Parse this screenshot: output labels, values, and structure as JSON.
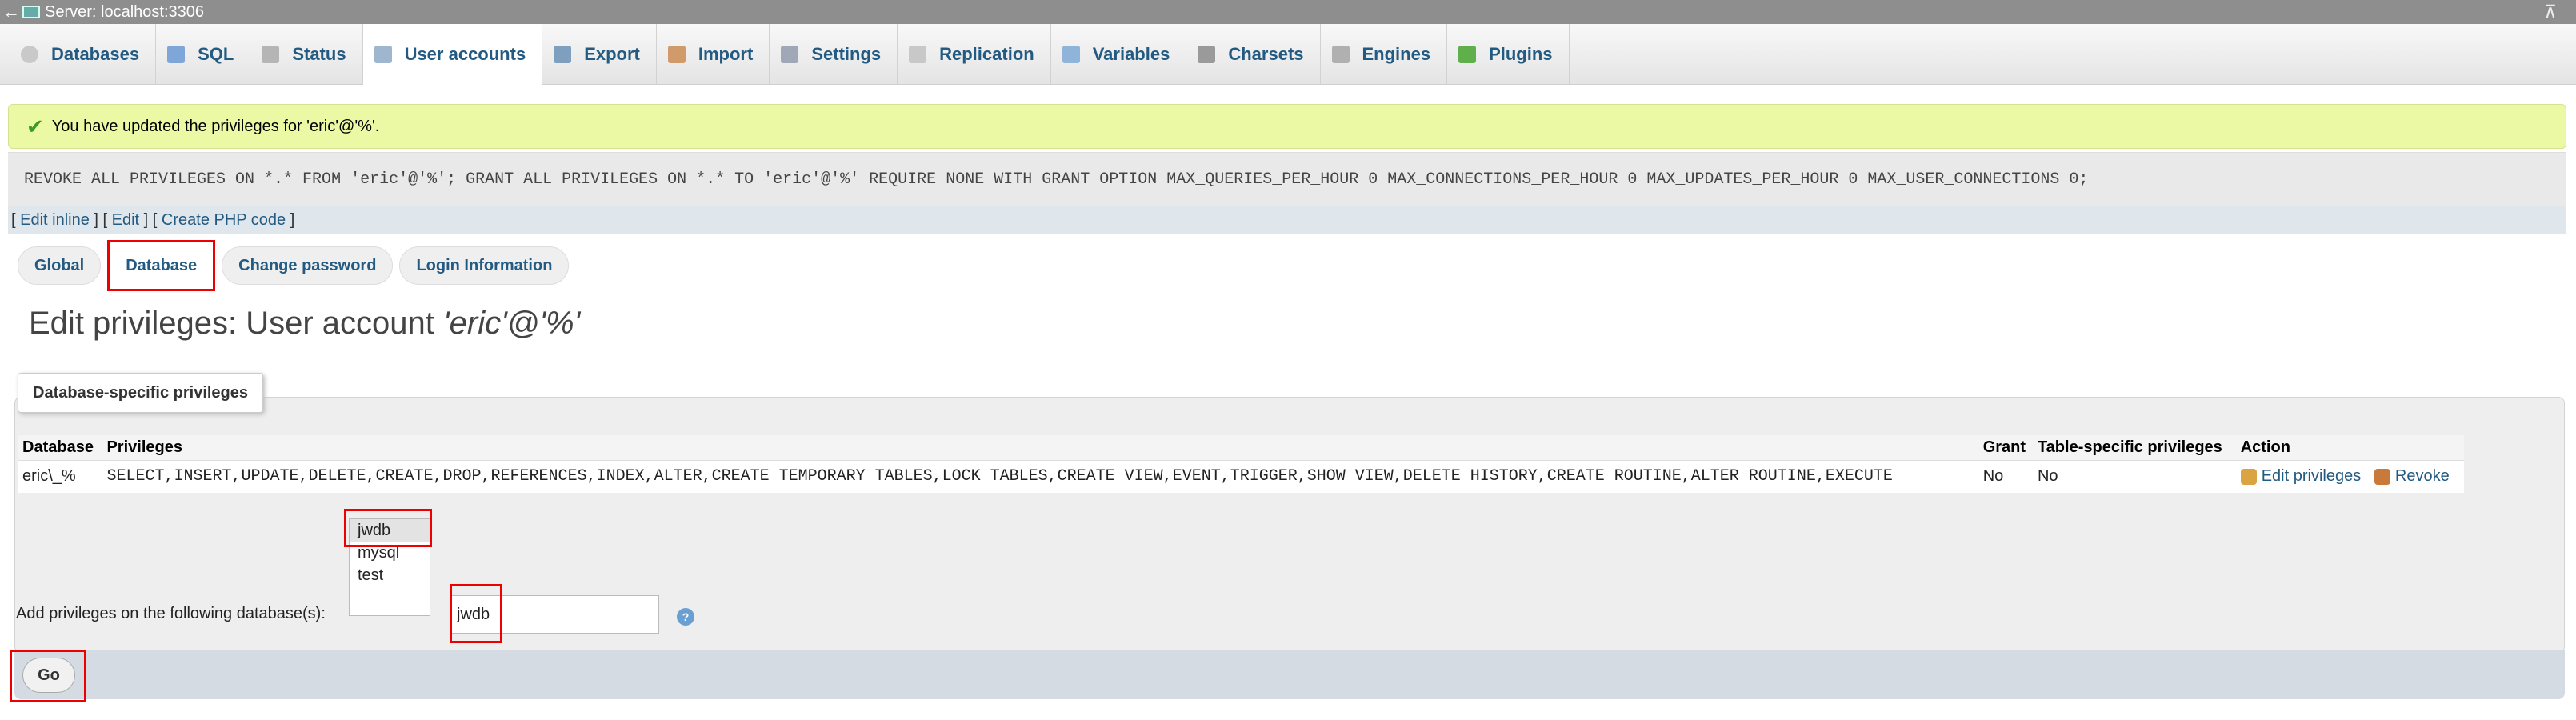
{
  "server_bar": {
    "title": "Server: localhost:3306"
  },
  "tabs": [
    {
      "label": "Databases",
      "icon": "database-icon"
    },
    {
      "label": "SQL",
      "icon": "sql-icon"
    },
    {
      "label": "Status",
      "icon": "status-icon"
    },
    {
      "label": "User accounts",
      "icon": "users-icon"
    },
    {
      "label": "Export",
      "icon": "export-icon"
    },
    {
      "label": "Import",
      "icon": "import-icon"
    },
    {
      "label": "Settings",
      "icon": "wrench-icon"
    },
    {
      "label": "Replication",
      "icon": "replication-icon"
    },
    {
      "label": "Variables",
      "icon": "variables-icon"
    },
    {
      "label": "Charsets",
      "icon": "charsets-icon"
    },
    {
      "label": "Engines",
      "icon": "engines-icon"
    },
    {
      "label": "Plugins",
      "icon": "plugin-icon"
    }
  ],
  "active_tab": "User accounts",
  "success_message": "You have updated the privileges for 'eric'@'%'.",
  "sql_query": "REVOKE ALL PRIVILEGES ON *.* FROM 'eric'@'%'; GRANT ALL PRIVILEGES ON *.* TO 'eric'@'%' REQUIRE NONE WITH GRANT OPTION MAX_QUERIES_PER_HOUR 0 MAX_CONNECTIONS_PER_HOUR 0 MAX_UPDATES_PER_HOUR 0 MAX_USER_CONNECTIONS 0;",
  "sql_links": {
    "edit_inline": "Edit inline",
    "edit": "Edit",
    "create_php": "Create PHP code"
  },
  "subtabs": [
    "Global",
    "Database",
    "Change password",
    "Login Information"
  ],
  "active_subtab": "Database",
  "page_title": {
    "prefix": "Edit privileges: User account ",
    "account": "'eric'@'%'"
  },
  "fieldset_legend": "Database-specific privileges",
  "table": {
    "headers": [
      "Database",
      "Privileges",
      "Grant",
      "Table-specific privileges",
      "Action"
    ],
    "rows": [
      {
        "database": "eric\\_%",
        "privileges": "SELECT,INSERT,UPDATE,DELETE,CREATE,DROP,REFERENCES,INDEX,ALTER,CREATE TEMPORARY TABLES,LOCK TABLES,CREATE VIEW,EVENT,TRIGGER,SHOW VIEW,DELETE HISTORY,CREATE ROUTINE,ALTER ROUTINE,EXECUTE",
        "grant": "No",
        "table_specific": "No",
        "edit_label": "Edit privileges",
        "revoke_label": "Revoke"
      }
    ]
  },
  "db_list": [
    "jwdb",
    "mysql",
    "test"
  ],
  "db_list_selected": "jwdb",
  "add_label": "Add privileges on the following database(s):",
  "db_input_value": "jwdb",
  "go_label": "Go",
  "colors": {
    "link": "#235a81",
    "success_bg": "#ebf8a4",
    "highlight": "#ee0000"
  }
}
